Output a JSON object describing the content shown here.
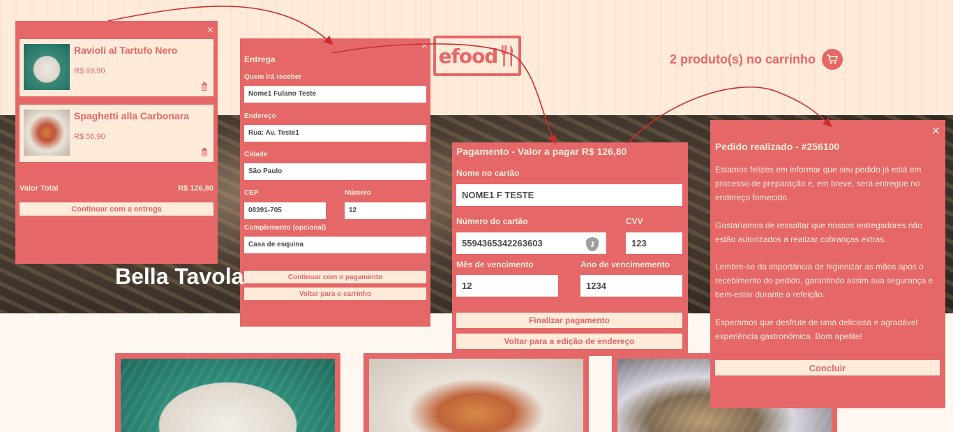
{
  "header": {
    "logo_text": "efood",
    "cart_text": "2 produto(s) no carrinho",
    "cart_icon": "cart-icon"
  },
  "hero": {
    "title": "Bella Tavola"
  },
  "cart": {
    "close": "×",
    "items": [
      {
        "name": "Ravioli al Tartufo Nero",
        "price": "R$ 69,90"
      },
      {
        "name": "Spaghetti alla Carbonara",
        "price": "R$ 56,90"
      }
    ],
    "total_label": "Valor Total",
    "total_value": "R$ 126,80",
    "continue_button": "Continuar com a entrega"
  },
  "delivery": {
    "close": "×",
    "title": "Entrega",
    "receiver_label": "Quem irá receber",
    "receiver_value": "Nome1 Fulano Teste",
    "address_label": "Endereço",
    "address_value": "Rua: Av. Teste1",
    "city_label": "Cidade",
    "city_value": "São Paulo",
    "cep_label": "CEP",
    "cep_value": "08391-705",
    "number_label": "Número",
    "number_value": "12",
    "complement_label": "Complemento (opcional)",
    "complement_value": "Casa de esquina",
    "continue_button": "Continuar com o pagamento",
    "back_button": "Voltar para o carrinho"
  },
  "payment": {
    "title": "Pagamento - Valor a pagar R$ 126,80",
    "card_name_label": "Nome no cartão",
    "card_name_value": "NOME1 F TESTE",
    "card_number_label": "Número do cartão",
    "card_number_value": "5594365342263603",
    "cvv_label": "CVV",
    "cvv_value": "123",
    "month_label": "Mês de vencimento",
    "month_value": "12",
    "year_label": "Ano de vencimemento",
    "year_value": "1234",
    "finish_button": "Finalizar pagamento",
    "back_button": "Voltar para a edição de endereço"
  },
  "confirmation": {
    "close": "×",
    "title": "Pedido realizado - #256100",
    "p1": "Estamos felizes em informar que seu pedido já está em processo de preparação e, em breve, será entregue no endereço fornecido.",
    "p2": "Gostaríamos de ressaltar que nossos entregadores não estão autorizados a realizar cobranças extras.",
    "p3": "Lembre-se da importância de higienizar as mãos após o recebimento do pedido, garantindo assim sua segurança e bem-estar durante a refeição.",
    "p4": "Esperamos que desfrute de uma deliciosa e agradável experiência gastronômica. Bom apetite!",
    "conclude_button": "Concluir"
  },
  "colors": {
    "accent": "#E66767",
    "light": "#FFEBD9",
    "background": "#FFF8F2"
  }
}
